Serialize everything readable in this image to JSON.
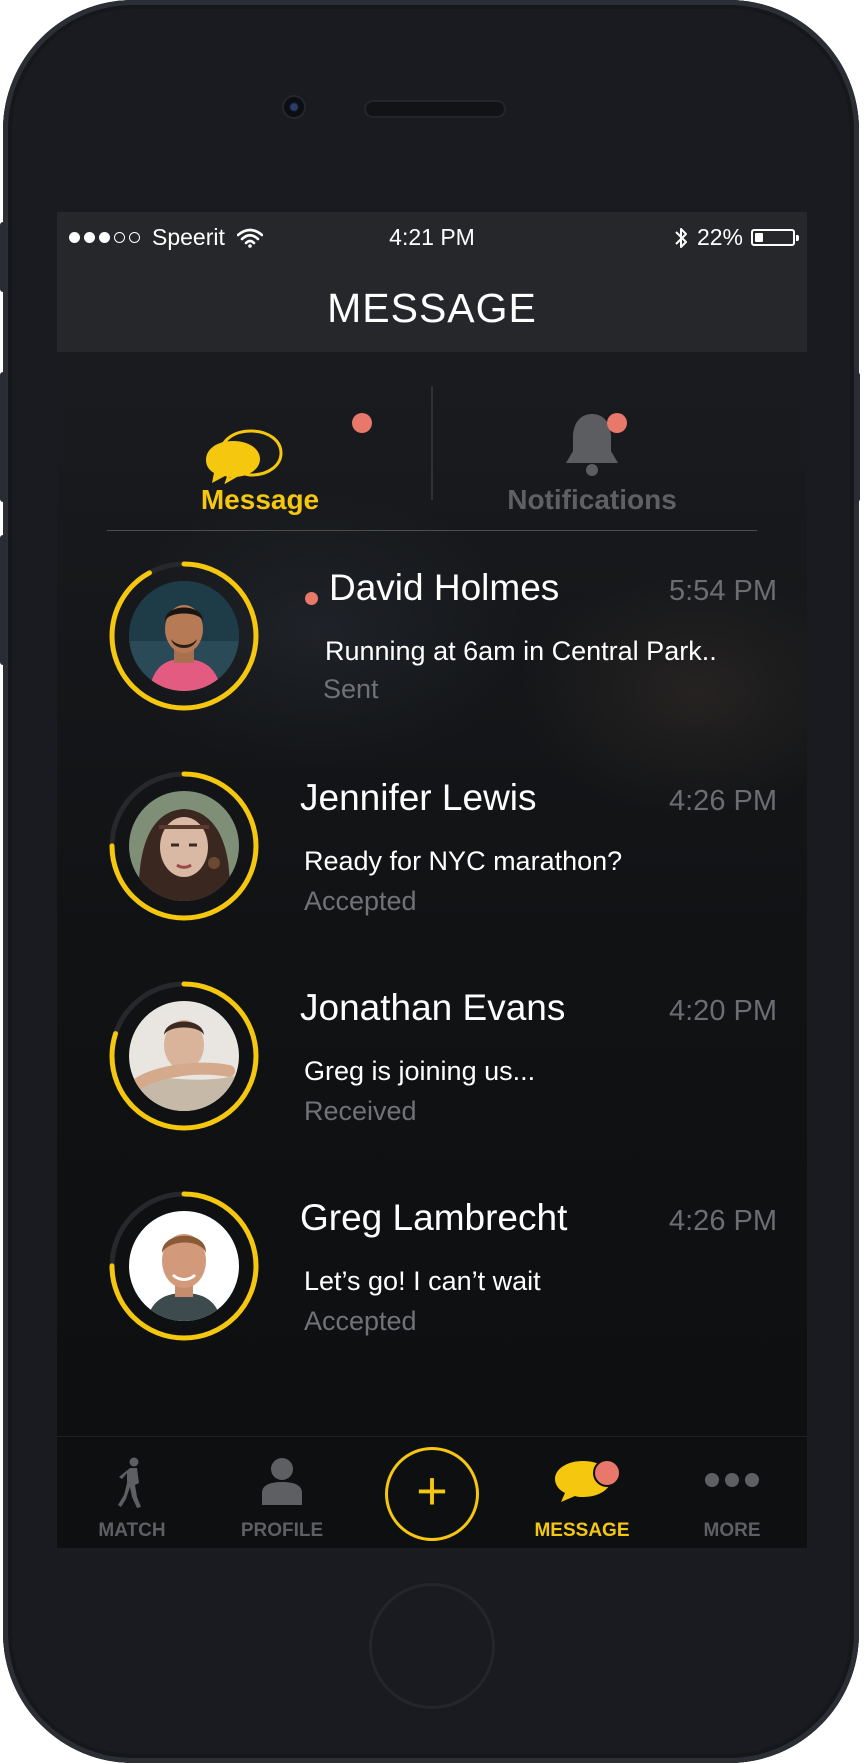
{
  "status_bar": {
    "carrier": "Speerit",
    "time": "4:21 PM",
    "battery": "22%",
    "battery_level": 0.22
  },
  "nav": {
    "title": "MESSAGE"
  },
  "segments": [
    {
      "label": "Message",
      "icon": "chat-bubbles-icon",
      "active": true,
      "badge": true
    },
    {
      "label": "Notifications",
      "icon": "bell-icon",
      "active": false,
      "badge": true
    }
  ],
  "conversations": [
    {
      "name": "David Holmes",
      "time": "5:54 PM",
      "preview": "Running at 6am in Central Park..",
      "status": "Sent",
      "unread": true,
      "progress": 0.92
    },
    {
      "name": "Jennifer Lewis",
      "time": "4:26 PM",
      "preview": "Ready for NYC marathon?",
      "status": "Accepted",
      "unread": false,
      "progress": 0.75
    },
    {
      "name": "Jonathan Evans",
      "time": "4:20 PM",
      "preview": "Greg is joining us...",
      "status": "Received",
      "unread": false,
      "progress": 0.8
    },
    {
      "name": "Greg Lambrecht",
      "time": "4:26 PM",
      "preview": "Let’s go! I can’t wait",
      "status": "Accepted",
      "unread": false,
      "progress": 0.75
    }
  ],
  "tab_bar": [
    {
      "label": "MATCH",
      "icon": "runner-icon",
      "active": false
    },
    {
      "label": "PROFILE",
      "icon": "person-icon",
      "active": false
    },
    {
      "label": "",
      "icon": "plus-icon",
      "active": false
    },
    {
      "label": "MESSAGE",
      "icon": "chat-bubble-icon",
      "active": true,
      "badge": true
    },
    {
      "label": "MORE",
      "icon": "more-dots-icon",
      "active": false
    }
  ],
  "colors": {
    "accent": "#f5c70f",
    "badge": "#e8786a",
    "muted": "#6b6d72"
  }
}
